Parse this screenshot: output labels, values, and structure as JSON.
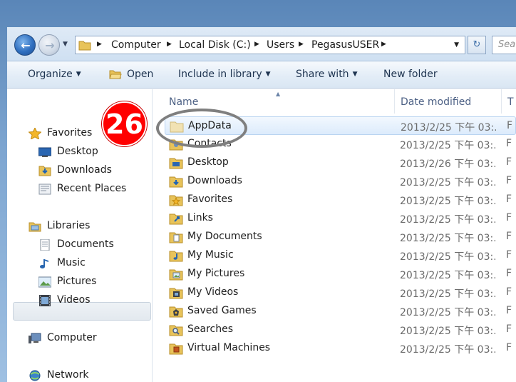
{
  "address_bar": {
    "crumbs": [
      "Computer",
      "Local Disk (C:)",
      "Users",
      "PegasusUSER"
    ],
    "search_placeholder": "Sea"
  },
  "toolbar": {
    "organize": "Organize",
    "open": "Open",
    "include_in_library": "Include in library",
    "share_with": "Share with",
    "new_folder": "New folder"
  },
  "nav": {
    "favorites": {
      "label": "Favorites",
      "items": [
        "Desktop",
        "Downloads",
        "Recent Places"
      ]
    },
    "libraries": {
      "label": "Libraries",
      "items": [
        "Documents",
        "Music",
        "Pictures",
        "Videos"
      ]
    },
    "computer": "Computer",
    "network": "Network"
  },
  "columns": {
    "name": "Name",
    "date_modified": "Date modified",
    "type": "T"
  },
  "files": [
    {
      "name": "AppData",
      "date": "2013/2/25 下午 03:...",
      "type": "F",
      "icon": "folder-hidden-icon"
    },
    {
      "name": "Contacts",
      "date": "2013/2/25 下午 03:...",
      "type": "F",
      "icon": "contacts-folder-icon"
    },
    {
      "name": "Desktop",
      "date": "2013/2/26 下午 03:...",
      "type": "F",
      "icon": "desktop-folder-icon"
    },
    {
      "name": "Downloads",
      "date": "2013/2/25 下午 03:...",
      "type": "F",
      "icon": "downloads-folder-icon"
    },
    {
      "name": "Favorites",
      "date": "2013/2/25 下午 03:...",
      "type": "F",
      "icon": "favorites-folder-icon"
    },
    {
      "name": "Links",
      "date": "2013/2/25 下午 03:...",
      "type": "F",
      "icon": "links-folder-icon"
    },
    {
      "name": "My Documents",
      "date": "2013/2/25 下午 03:...",
      "type": "F",
      "icon": "documents-folder-icon"
    },
    {
      "name": "My Music",
      "date": "2013/2/25 下午 03:...",
      "type": "F",
      "icon": "music-folder-icon"
    },
    {
      "name": "My Pictures",
      "date": "2013/2/25 下午 03:...",
      "type": "F",
      "icon": "pictures-folder-icon"
    },
    {
      "name": "My Videos",
      "date": "2013/2/25 下午 03:...",
      "type": "F",
      "icon": "videos-folder-icon"
    },
    {
      "name": "Saved Games",
      "date": "2013/2/25 下午 03:...",
      "type": "F",
      "icon": "saved-games-folder-icon"
    },
    {
      "name": "Searches",
      "date": "2013/2/25 下午 03:...",
      "type": "F",
      "icon": "searches-folder-icon"
    },
    {
      "name": "Virtual Machines",
      "date": "2013/2/25 下午 03:...",
      "type": "F",
      "icon": "folder-icon"
    }
  ],
  "annotation": {
    "step_number": "26",
    "badge_color": "#ff0000",
    "ring_color": "#7f7f7f"
  },
  "colors": {
    "selection": "#dcebfc",
    "folder": "#e8c35a"
  }
}
